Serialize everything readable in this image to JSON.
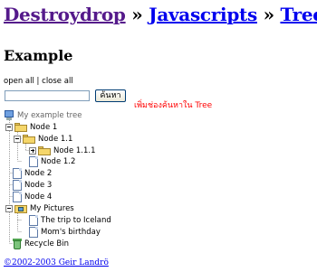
{
  "breadcrumb": {
    "item1": "Destroydrop",
    "sep1": " » ",
    "item2": "Javascripts",
    "sep2": " » ",
    "item3": "Tree"
  },
  "heading": "Example",
  "controls": {
    "open_all": "open all",
    "separator": " | ",
    "close_all": "close all"
  },
  "search": {
    "value": "",
    "placeholder": "",
    "button_label": "ค้นหา",
    "hint": "เพิ่มช่องค้นหาใน Tree",
    "hint_color": "#ff0000"
  },
  "tree": {
    "root": "My example tree",
    "node1": "Node 1",
    "node1_1": "Node 1.1",
    "node1_1_1": "Node 1.1.1",
    "node1_2": "Node 1.2",
    "node2": "Node 2",
    "node3": "Node 3",
    "node4": "Node 4",
    "pictures": "My Pictures",
    "pic1": "The trip to Iceland",
    "pic2": "Mom's birthday",
    "bin": "Recycle Bin"
  },
  "footer": "©2002-2003 Geir Landrö"
}
